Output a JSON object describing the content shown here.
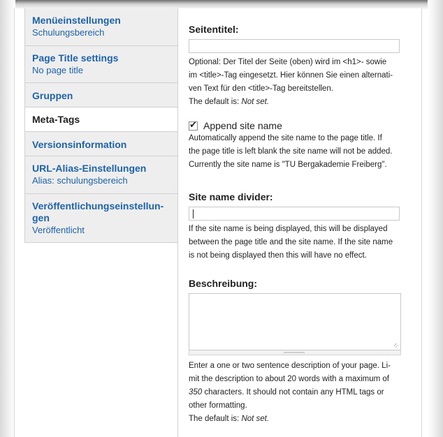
{
  "tabs": [
    {
      "title": "Menüeinstellungen",
      "summary": "Schulungsbereich"
    },
    {
      "title": "Page Title settings",
      "summary": "No page title"
    },
    {
      "title": "Gruppen",
      "summary": ""
    },
    {
      "title": "Meta-Tags",
      "summary": "",
      "active": true
    },
    {
      "title": "Versionsinformation",
      "summary": ""
    },
    {
      "title": "URL-Alias-Einstellungen",
      "summary": "Alias: schulungsbereich"
    },
    {
      "title": "Veröffentlichungseinstellun-\ngen",
      "summary": "Veröffentlicht"
    }
  ],
  "seitentitel": {
    "label": "Seitentitel:",
    "value": "",
    "desc_lines": [
      "Optional: Der Titel der Seite (oben) wird im <h1>- sowie",
      "im <title>-Tag eingesetzt. Hier können Sie einen alternati-",
      "ven Text für den <title>-Tag bereitstellen."
    ],
    "default_prefix": "The default is: ",
    "default_value": "Not set."
  },
  "append_site_name": {
    "label": "Append site name",
    "checked": true,
    "desc_lines": [
      "Automatically append the site name to the page title. If",
      "the page title is left blank the site name will not be added.",
      "Currently the site name is \"TU Bergakademie Freiberg\"."
    ]
  },
  "site_name_divider": {
    "label": "Site name divider:",
    "value": "",
    "desc_lines": [
      "If the site name is being displayed, this will be displayed",
      "between the page title and the site name. If the site name",
      "is not being displayed then this will have no effect."
    ]
  },
  "beschreibung": {
    "label": "Beschreibung:",
    "value": "",
    "desc_line1": "Enter a one or two sentence description of your page. Li-",
    "desc_line2": "mit the description to about 20 words with a maximum of",
    "desc_line3_num": "350",
    "desc_line3_rest": " characters. It should not contain any HTML tags or",
    "desc_line4": "other formatting.",
    "default_prefix": "The default is: ",
    "default_value": "Not set."
  }
}
